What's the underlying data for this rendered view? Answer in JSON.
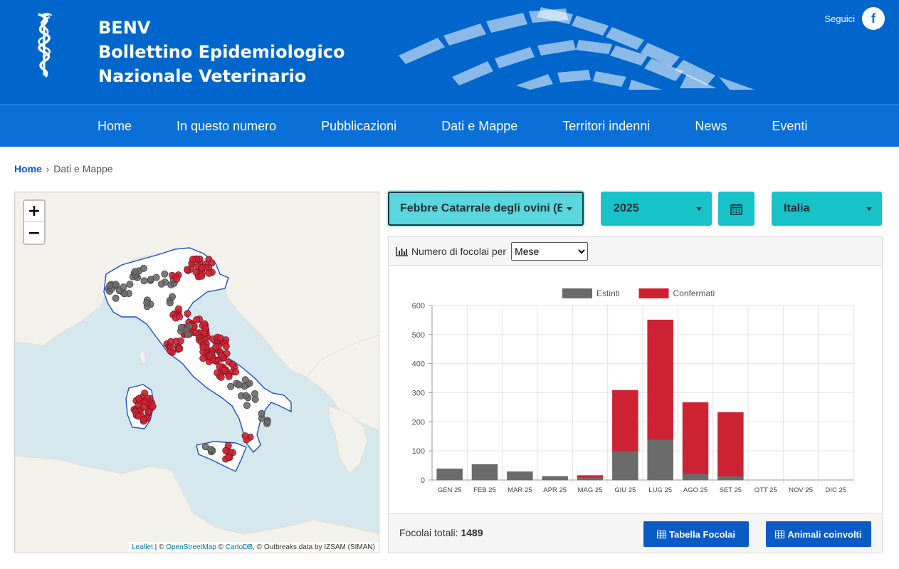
{
  "header": {
    "title_lines": [
      "BENV",
      "Bollettino Epidemiologico",
      "Nazionale Veterinario"
    ],
    "follow_label": "Seguici",
    "facebook_glyph": "f",
    "colors": {
      "brand": "#0066cc",
      "nav": "#0a6fd6"
    }
  },
  "nav": {
    "items": [
      "Home",
      "In questo numero",
      "Pubblicazioni",
      "Dati e Mappe",
      "Territori indenni",
      "News",
      "Eventi"
    ]
  },
  "breadcrumb": {
    "home": "Home",
    "separator": "›",
    "current": "Dati e Mappe"
  },
  "map": {
    "zoom_in": "+",
    "zoom_out": "−",
    "attribution": {
      "leaflet": "Leaflet",
      "sep1": " | © ",
      "osm": "OpenStreetMap",
      "sep2": " © ",
      "carto": "CartoDB",
      "rest": ", © Outbreaks data by IZSAM (SIMAN)"
    },
    "marker_colors": {
      "estinti": "#6b6b6b",
      "confermati": "#cc2233"
    }
  },
  "filters": {
    "disease": "Febbre Catarrale degli ovini (Bluetongue)",
    "year": "2025",
    "calendar_icon": "calendar-icon",
    "region": "Italia"
  },
  "panel": {
    "heading": "Numero di focolai per",
    "period_options": [
      "Mese"
    ],
    "period_selected": "Mese",
    "total_label": "Focolai totali:",
    "total_value": "1489",
    "btn_focolai": "Tabella Focolai",
    "btn_animali": "Animali coinvolti",
    "table_icon": "table-icon"
  },
  "chart_data": {
    "type": "bar",
    "stacked": true,
    "categories": [
      "GEN 25",
      "FEB 25",
      "MAR 25",
      "APR 25",
      "MAG 25",
      "GIU 25",
      "LUG 25",
      "AGO 25",
      "SET 25",
      "OTT 25",
      "NOV 25",
      "DIC 25"
    ],
    "series": [
      {
        "name": "Estinti",
        "color": "#6b6b6b",
        "values": [
          38,
          53,
          28,
          12,
          10,
          100,
          140,
          22,
          14,
          0,
          0,
          0
        ]
      },
      {
        "name": "Confermati",
        "color": "#cc2233",
        "values": [
          0,
          0,
          0,
          0,
          5,
          208,
          410,
          244,
          218,
          0,
          0,
          0
        ]
      }
    ],
    "ylim": [
      0,
      600
    ],
    "yticks": [
      0,
      100,
      200,
      300,
      400,
      500,
      600
    ],
    "legend": "top",
    "grid": true
  }
}
